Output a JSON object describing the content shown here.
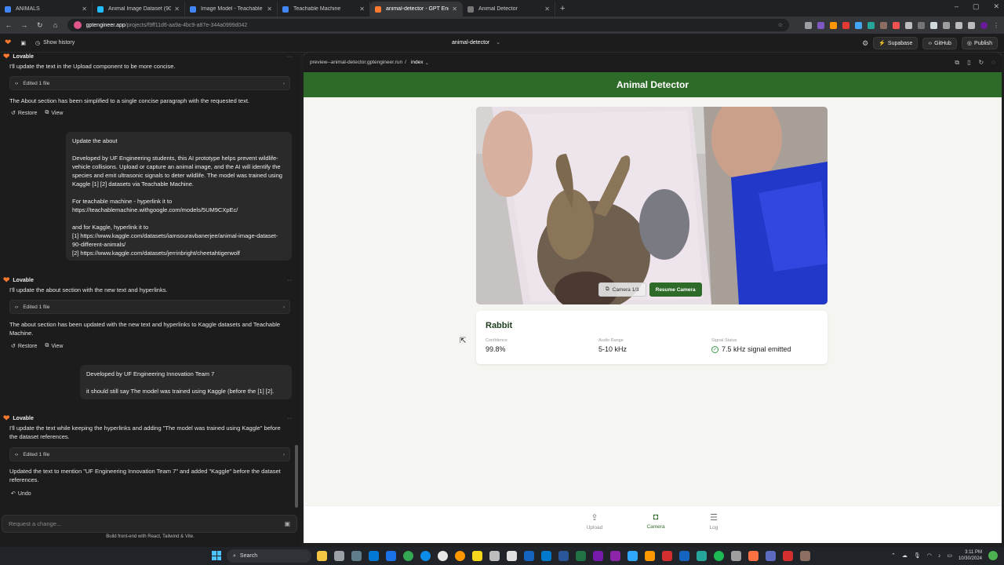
{
  "browser": {
    "tabs": [
      {
        "title": "ANIMALS",
        "color": "#4285f4"
      },
      {
        "title": "Animal Image Dataset (90 Diffe",
        "color": "#20beff"
      },
      {
        "title": "Image Model - Teachable Machi",
        "color": "#4285f4"
      },
      {
        "title": "Teachable Machine",
        "color": "#4285f4"
      },
      {
        "title": "animal-detector - GPT Eng",
        "color": "#ff7a2f",
        "active": true
      },
      {
        "title": "Animal Detector",
        "color": "#777777"
      }
    ],
    "url_host": "gptengineer.app",
    "url_path": "/projects/f9ff11d6-aa9a-4bc9-a87e-344a0999d042"
  },
  "lovable_header": {
    "show_history": "Show history",
    "project_name": "animal-detector",
    "supabase": "Supabase",
    "github": "GitHub",
    "publish": "Publish"
  },
  "chat": {
    "author": "Lovable",
    "block1": {
      "text": "I'll update the text in the Upload component to be more concise.",
      "edited": "Edited 1 file",
      "summary": "The About section has been simplified to a single concise paragraph with the requested text.",
      "restore": "Restore",
      "view": "View"
    },
    "user1": {
      "line1": "Update the about",
      "para": "Developed by UF Engineering students, this AI prototype helps prevent wildlife-vehicle collisions. Upload or capture an animal image, and the AI will identify the species and emit ultrasonic signals to deter wildlife. The model was trained using Kaggle [1] [2] datasets via Teachable Machine.",
      "tm1": "For teachable machine - hyperlink it to",
      "tm2": "https://teachablemachine.withgoogle.com/models/5UM9CXpEc/",
      "k1": "and for Kaggle, hyperlink it to",
      "k2": "[1] https://www.kaggle.com/datasets/iamsouravbanerjee/animal-image-dataset-90-different-animals/",
      "k3": "[2] https://www.kaggle.com/datasets/jerrinbright/cheetahtigerwolf"
    },
    "block2": {
      "text": "I'll update the about section with the new text and hyperlinks.",
      "edited": "Edited 1 file",
      "summary": "The about section has been updated with the new text and hyperlinks to Kaggle datasets and Teachable Machine.",
      "restore": "Restore",
      "view": "View"
    },
    "user2": {
      "line1": "Developed by UF Engineering Innovation Team 7",
      "line2": "it should still say The model was trained using Kaggle (before the [1] [2]."
    },
    "block3": {
      "text": "I'll update the text while keeping the hyperlinks and adding \"The model was trained using Kaggle\" before the dataset references.",
      "edited": "Edited 1 file",
      "summary": "Updated the text to mention \"UF Engineering Innovation Team 7\" and added \"Kaggle\" before the dataset references.",
      "undo": "Undo"
    },
    "input_placeholder": "Request a change...",
    "footer": "Build front-end with React, Tailwind & Vite."
  },
  "preview": {
    "url": "preview--animal-detector.gptengineer.run",
    "route": "index",
    "app_title": "Animal Detector",
    "camera_label": "Camera 1/3",
    "resume_label": "Resume Camera",
    "result": {
      "species": "Rabbit",
      "confidence_label": "Confidence",
      "confidence": "99.8%",
      "audio_label": "Audio Range",
      "audio": "5-10 kHz",
      "signal_label": "Signal Status",
      "signal": "7.5 kHz signal emitted"
    },
    "nav": {
      "upload": "Upload",
      "camera": "Camera",
      "log": "Log"
    }
  },
  "taskbar": {
    "search": "Search",
    "time": "3:11 PM",
    "date": "10/30/2024"
  },
  "colors": {
    "app_green": "#2e6b28",
    "lovable_orange": "#ff7a2f"
  }
}
